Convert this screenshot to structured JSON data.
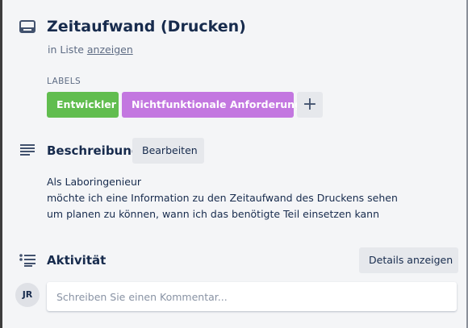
{
  "card": {
    "title": "Zeitaufwand (Drucken)",
    "list_prefix": "in Liste ",
    "list_link": "anzeigen"
  },
  "labels": {
    "heading": "LABELS",
    "items": [
      {
        "text": "Entwickler",
        "color": "#61bd4f"
      },
      {
        "text": "Nichtfunktionale Anforderung",
        "color": "#c377e0"
      }
    ],
    "add_symbol": "+"
  },
  "description": {
    "title": "Beschreibung",
    "edit_label": "Bearbeiten",
    "lines": [
      "Als Laboringenieur",
      "möchte ich eine Information zu den Zeitaufwand des Druckens sehen",
      "um planen zu können, wann ich das benötigte Teil einsetzen kann"
    ]
  },
  "activity": {
    "title": "Aktivität",
    "details_label": "Details anzeigen",
    "avatar_initials": "JR",
    "comment_placeholder": "Schreiben Sie einen Kommentar..."
  },
  "icons": {
    "card": "card-icon",
    "description": "description-lines-icon",
    "activity": "activity-list-icon"
  }
}
